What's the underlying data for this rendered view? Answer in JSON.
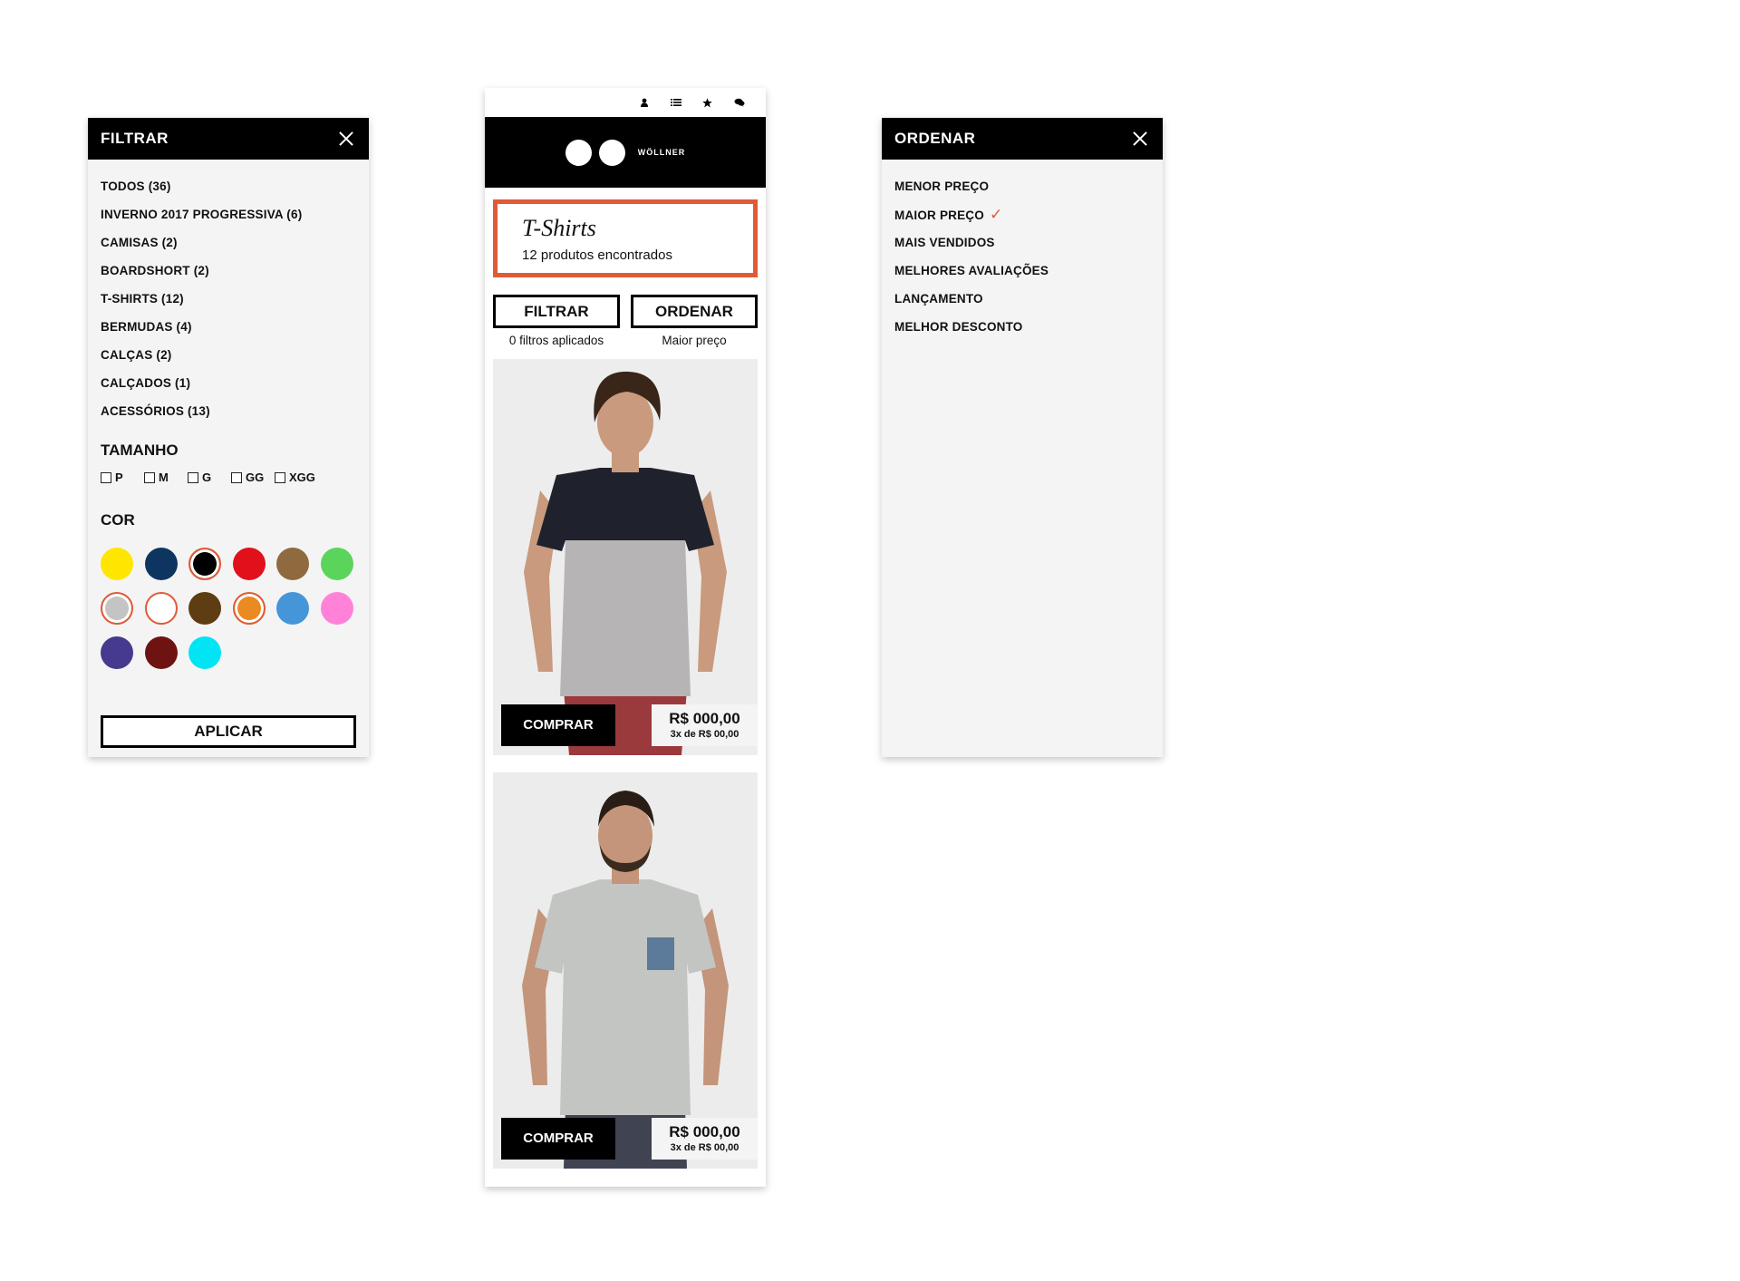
{
  "filter": {
    "title": "FILTRAR",
    "categories": [
      "TODOS (36)",
      "INVERNO 2017 PROGRESSIVA (6)",
      "CAMISAS (2)",
      "BOARDSHORT (2)",
      "T-SHIRTS (12)",
      "BERMUDAS (4)",
      "CALÇAS (2)",
      "CALÇADOS (1)",
      "ACESSÓRIOS (13)"
    ],
    "size_title": "TAMANHO",
    "sizes": [
      "P",
      "M",
      "G",
      "GG",
      "XGG"
    ],
    "color_title": "COR",
    "colors": [
      {
        "hex": "#ffe600",
        "selected": false
      },
      {
        "hex": "#0d3560",
        "selected": false
      },
      {
        "hex": "#000000",
        "selected": true
      },
      {
        "hex": "#e0111a",
        "selected": false
      },
      {
        "hex": "#8f6a3e",
        "selected": false
      },
      {
        "hex": "#5bd45b",
        "selected": false
      },
      {
        "hex": "#c4c4c4",
        "selected": true
      },
      {
        "hex": "#ffffff",
        "selected": true
      },
      {
        "hex": "#5e3d12",
        "selected": false
      },
      {
        "hex": "#ea8a22",
        "selected": true
      },
      {
        "hex": "#4596d8",
        "selected": false
      },
      {
        "hex": "#ff82d8",
        "selected": false
      },
      {
        "hex": "#453a8e",
        "selected": false
      },
      {
        "hex": "#6e1212",
        "selected": false
      },
      {
        "hex": "#00e4f4",
        "selected": false
      }
    ],
    "apply_label": "APLICAR"
  },
  "phone": {
    "brand": "WÖLLNER",
    "category_title": "T-Shirts",
    "category_count": "12 produtos encontrados",
    "filter_button": "FILTRAR",
    "order_button": "ORDENAR",
    "filters_applied": "0 filtros aplicados",
    "current_order": "Maior preço",
    "products": [
      {
        "buy_label": "COMPRAR",
        "price": "R$ 000,00",
        "installments": "3x de R$ 00,00",
        "shirt": "colorblock"
      },
      {
        "buy_label": "COMPRAR",
        "price": "R$ 000,00",
        "installments": "3x de R$ 00,00",
        "shirt": "pocket"
      }
    ]
  },
  "order": {
    "title": "ORDENAR",
    "options": [
      "MENOR PREÇO",
      "MAIOR PREÇO",
      "MAIS VENDIDOS",
      "MELHORES AVALIAÇÕES",
      "LANÇAMENTO",
      "MELHOR DESCONTO"
    ],
    "selected_index": 1
  },
  "colors": {
    "accent": "#e05a36",
    "header": "#000000",
    "panel_bg": "#f4f4f4"
  }
}
